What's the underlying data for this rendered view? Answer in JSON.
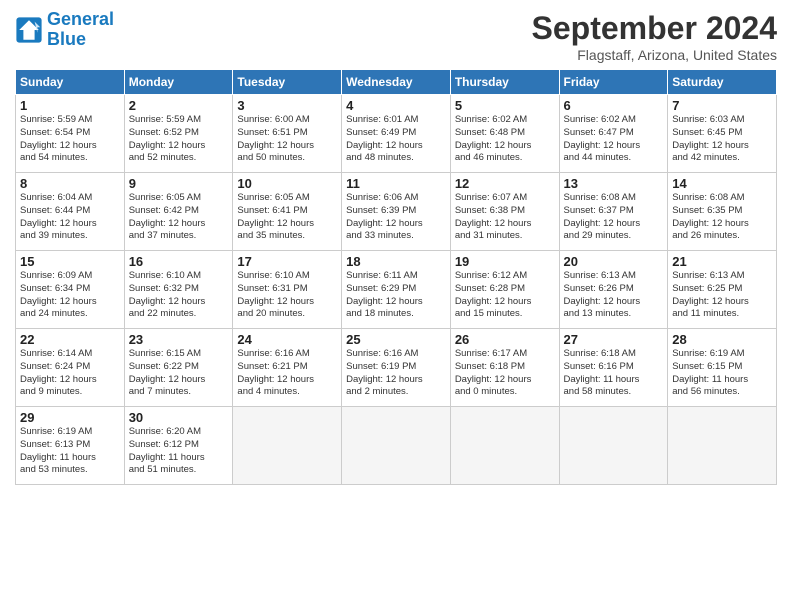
{
  "header": {
    "logo_line1": "General",
    "logo_line2": "Blue",
    "title": "September 2024",
    "subtitle": "Flagstaff, Arizona, United States"
  },
  "calendar": {
    "days_of_week": [
      "Sunday",
      "Monday",
      "Tuesday",
      "Wednesday",
      "Thursday",
      "Friday",
      "Saturday"
    ],
    "weeks": [
      [
        {
          "day": "1",
          "rise": "5:59 AM",
          "set": "6:54 PM",
          "daylight": "12 hours and 54 minutes."
        },
        {
          "day": "2",
          "rise": "5:59 AM",
          "set": "6:52 PM",
          "daylight": "12 hours and 52 minutes."
        },
        {
          "day": "3",
          "rise": "6:00 AM",
          "set": "6:51 PM",
          "daylight": "12 hours and 50 minutes."
        },
        {
          "day": "4",
          "rise": "6:01 AM",
          "set": "6:49 PM",
          "daylight": "12 hours and 48 minutes."
        },
        {
          "day": "5",
          "rise": "6:02 AM",
          "set": "6:48 PM",
          "daylight": "12 hours and 46 minutes."
        },
        {
          "day": "6",
          "rise": "6:02 AM",
          "set": "6:47 PM",
          "daylight": "12 hours and 44 minutes."
        },
        {
          "day": "7",
          "rise": "6:03 AM",
          "set": "6:45 PM",
          "daylight": "12 hours and 42 minutes."
        }
      ],
      [
        {
          "day": "8",
          "rise": "6:04 AM",
          "set": "6:44 PM",
          "daylight": "12 hours and 39 minutes."
        },
        {
          "day": "9",
          "rise": "6:05 AM",
          "set": "6:42 PM",
          "daylight": "12 hours and 37 minutes."
        },
        {
          "day": "10",
          "rise": "6:05 AM",
          "set": "6:41 PM",
          "daylight": "12 hours and 35 minutes."
        },
        {
          "day": "11",
          "rise": "6:06 AM",
          "set": "6:39 PM",
          "daylight": "12 hours and 33 minutes."
        },
        {
          "day": "12",
          "rise": "6:07 AM",
          "set": "6:38 PM",
          "daylight": "12 hours and 31 minutes."
        },
        {
          "day": "13",
          "rise": "6:08 AM",
          "set": "6:37 PM",
          "daylight": "12 hours and 29 minutes."
        },
        {
          "day": "14",
          "rise": "6:08 AM",
          "set": "6:35 PM",
          "daylight": "12 hours and 26 minutes."
        }
      ],
      [
        {
          "day": "15",
          "rise": "6:09 AM",
          "set": "6:34 PM",
          "daylight": "12 hours and 24 minutes."
        },
        {
          "day": "16",
          "rise": "6:10 AM",
          "set": "6:32 PM",
          "daylight": "12 hours and 22 minutes."
        },
        {
          "day": "17",
          "rise": "6:10 AM",
          "set": "6:31 PM",
          "daylight": "12 hours and 20 minutes."
        },
        {
          "day": "18",
          "rise": "6:11 AM",
          "set": "6:29 PM",
          "daylight": "12 hours and 18 minutes."
        },
        {
          "day": "19",
          "rise": "6:12 AM",
          "set": "6:28 PM",
          "daylight": "12 hours and 15 minutes."
        },
        {
          "day": "20",
          "rise": "6:13 AM",
          "set": "6:26 PM",
          "daylight": "12 hours and 13 minutes."
        },
        {
          "day": "21",
          "rise": "6:13 AM",
          "set": "6:25 PM",
          "daylight": "12 hours and 11 minutes."
        }
      ],
      [
        {
          "day": "22",
          "rise": "6:14 AM",
          "set": "6:24 PM",
          "daylight": "12 hours and 9 minutes."
        },
        {
          "day": "23",
          "rise": "6:15 AM",
          "set": "6:22 PM",
          "daylight": "12 hours and 7 minutes."
        },
        {
          "day": "24",
          "rise": "6:16 AM",
          "set": "6:21 PM",
          "daylight": "12 hours and 4 minutes."
        },
        {
          "day": "25",
          "rise": "6:16 AM",
          "set": "6:19 PM",
          "daylight": "12 hours and 2 minutes."
        },
        {
          "day": "26",
          "rise": "6:17 AM",
          "set": "6:18 PM",
          "daylight": "12 hours and 0 minutes."
        },
        {
          "day": "27",
          "rise": "6:18 AM",
          "set": "6:16 PM",
          "daylight": "11 hours and 58 minutes."
        },
        {
          "day": "28",
          "rise": "6:19 AM",
          "set": "6:15 PM",
          "daylight": "11 hours and 56 minutes."
        }
      ],
      [
        {
          "day": "29",
          "rise": "6:19 AM",
          "set": "6:13 PM",
          "daylight": "11 hours and 53 minutes."
        },
        {
          "day": "30",
          "rise": "6:20 AM",
          "set": "6:12 PM",
          "daylight": "11 hours and 51 minutes."
        },
        {
          "day": "",
          "rise": "",
          "set": "",
          "daylight": ""
        },
        {
          "day": "",
          "rise": "",
          "set": "",
          "daylight": ""
        },
        {
          "day": "",
          "rise": "",
          "set": "",
          "daylight": ""
        },
        {
          "day": "",
          "rise": "",
          "set": "",
          "daylight": ""
        },
        {
          "day": "",
          "rise": "",
          "set": "",
          "daylight": ""
        }
      ]
    ]
  }
}
